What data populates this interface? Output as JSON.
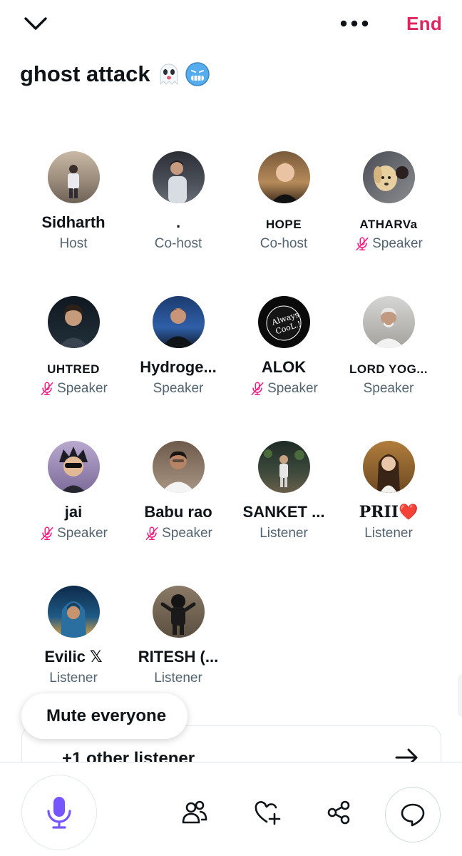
{
  "header": {
    "collapse_icon": "chevron-down-icon",
    "more_icon": "more-horizontal-icon",
    "end_label": "End",
    "end_color": "#e0245e"
  },
  "space": {
    "title": "ghost attack",
    "emojis": [
      "ghost-emoji",
      "cold-face-emoji"
    ]
  },
  "participants": [
    {
      "name": "Sidharth",
      "role": "Host",
      "muted": false,
      "style": "normal"
    },
    {
      "name": ".",
      "role": "Co-host",
      "muted": false,
      "style": "normal"
    },
    {
      "name": "HOPE",
      "role": "Co-host",
      "muted": false,
      "style": "small"
    },
    {
      "name": "ATHARVa",
      "role": "Speaker",
      "muted": true,
      "style": "small"
    },
    {
      "name": "UHTRED",
      "role": "Speaker",
      "muted": true,
      "style": "small"
    },
    {
      "name": "Hydroge...",
      "role": "Speaker",
      "muted": false,
      "style": "normal"
    },
    {
      "name": "ALOK",
      "role": "Speaker",
      "muted": true,
      "style": "normal"
    },
    {
      "name": "LORD YOG...",
      "role": "Speaker",
      "muted": false,
      "style": "small"
    },
    {
      "name": "jai",
      "role": "Speaker",
      "muted": true,
      "style": "normal"
    },
    {
      "name": "Babu rao",
      "role": "Speaker",
      "muted": true,
      "style": "normal"
    },
    {
      "name": "SANKET ...",
      "role": "Listener",
      "muted": false,
      "style": "normal"
    },
    {
      "name": "PRII❤️",
      "role": "Listener",
      "muted": false,
      "style": "serif"
    },
    {
      "name": "Evilic 𝕏",
      "role": "Listener",
      "muted": false,
      "style": "normal"
    },
    {
      "name": "RITESH (...",
      "role": "Listener",
      "muted": false,
      "style": "normal"
    }
  ],
  "mute_everyone_label": "Mute everyone",
  "other_listeners_label": "+1 other listener",
  "bottom_bar": {
    "mic_icon": "microphone-icon",
    "people_icon": "people-icon",
    "react_icon": "heart-plus-icon",
    "share_icon": "share-icon",
    "chat_icon": "chat-bubble-icon",
    "accent": "#7856ff"
  },
  "colors": {
    "muted_mic": "#f91880",
    "role_text": "#536471"
  }
}
